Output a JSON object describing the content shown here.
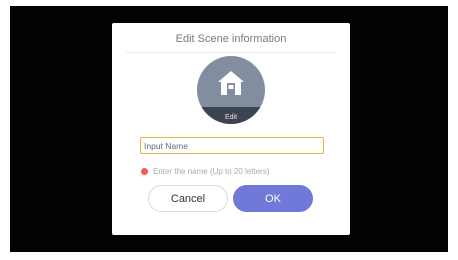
{
  "dialog": {
    "title": "Edit Scene information",
    "avatar_edit_label": "Edit",
    "avatar_icon": "home-icon",
    "name_input": {
      "placeholder": "Input Name",
      "value": ""
    },
    "hint": "Enter the name (Up to 20 letters)",
    "cancel_label": "Cancel",
    "ok_label": "OK"
  },
  "colors": {
    "background": "#030303",
    "ok_button": "#6f79d8",
    "input_border": "#f2b04a",
    "hint_dot": "#ef5b5b",
    "avatar": "#828da0"
  }
}
